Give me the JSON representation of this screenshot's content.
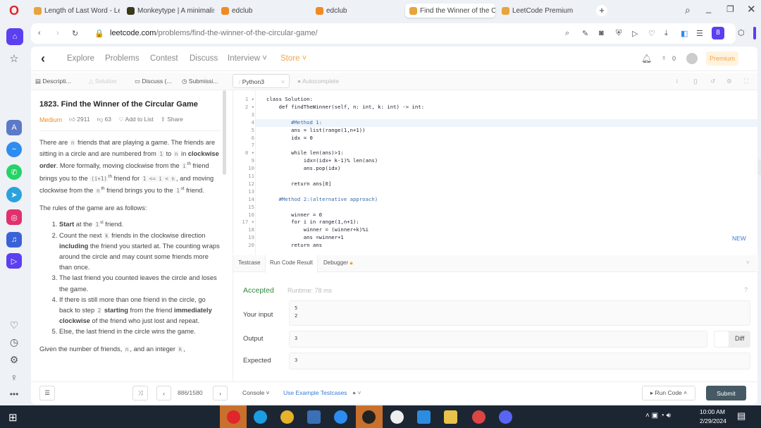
{
  "browser": {
    "tabs": [
      {
        "label": "Length of Last Word - Lee",
        "color": "#e8a33b"
      },
      {
        "label": "Monkeytype | A minimalis",
        "color": "#3a3a1a"
      },
      {
        "label": "edclub",
        "color": "#f08a24"
      },
      {
        "label": "edclub",
        "color": "#f08a24"
      },
      {
        "label": "Find the Winner of the Ci",
        "color": "#e8a33b"
      },
      {
        "label": "LeetCode Premium",
        "color": "#e8a33b"
      }
    ],
    "url_domain": "leetcode.com",
    "url_path": "/problems/find-the-winner-of-the-circular-game/"
  },
  "nav": {
    "items": [
      "Explore",
      "Problems",
      "Contest",
      "Discuss",
      "Interview ˅"
    ],
    "store": "Store ˅",
    "coins": "0",
    "premium": "Premium"
  },
  "subtabs": {
    "description": "Descripti...",
    "solution": "Solution",
    "discuss": "Discuss (...",
    "submissions": "Submissi...",
    "language": "Python3",
    "autocomplete": "Autocomplete"
  },
  "problem": {
    "title": "1823. Find the Winner of the Circular Game",
    "difficulty": "Medium",
    "likes": "2911",
    "dislikes": "63",
    "add_to_list": "Add to List",
    "share": "Share",
    "paragraphs": [
      [
        {
          "t": "There are "
        },
        {
          "c": "n"
        },
        {
          "t": " friends that are playing a game. The friends are sitting in a circle and are numbered from "
        },
        {
          "c": "1"
        },
        {
          "t": " to "
        },
        {
          "c": "n"
        },
        {
          "t": " in "
        },
        {
          "b": "clockwise order"
        },
        {
          "t": ". More formally, moving clockwise from the "
        },
        {
          "c": "i"
        },
        {
          "s": "th"
        },
        {
          "t": " friend brings you to the "
        },
        {
          "c": "(i+1)"
        },
        {
          "s": "th"
        },
        {
          "t": " friend for "
        },
        {
          "c": "1 <= i < n"
        },
        {
          "t": ", and moving clockwise from the "
        },
        {
          "c": "n"
        },
        {
          "s": "th"
        },
        {
          "t": " friend brings you to the "
        },
        {
          "c": "1"
        },
        {
          "s": "st"
        },
        {
          "t": " friend."
        }
      ],
      [
        {
          "t": "The rules of the game are as follows:"
        }
      ]
    ],
    "rules": [
      [
        {
          "b": "Start"
        },
        {
          "t": " at the "
        },
        {
          "c": "1"
        },
        {
          "s": "st"
        },
        {
          "t": " friend."
        }
      ],
      [
        {
          "t": "Count the next "
        },
        {
          "c": "k"
        },
        {
          "t": " friends in the clockwise direction "
        },
        {
          "b": "including"
        },
        {
          "t": " the friend you started at. The counting wraps around the circle and may count some friends more than once."
        }
      ],
      [
        {
          "t": "The last friend you counted leaves the circle and loses the game."
        }
      ],
      [
        {
          "t": "If there is still more than one friend in the circle, go back to step "
        },
        {
          "c": "2"
        },
        {
          "t": " "
        },
        {
          "b": "starting"
        },
        {
          "t": " from the friend "
        },
        {
          "b": "immediately clockwise"
        },
        {
          "t": " of the friend who just lost and repeat."
        }
      ],
      [
        {
          "t": "Else, the last friend in the circle wins the game."
        }
      ]
    ],
    "tail": [
      {
        "t": "Given the number of friends, "
      },
      {
        "c": "n"
      },
      {
        "t": ", and an integer "
      },
      {
        "c": "k"
      },
      {
        "t": ","
      }
    ]
  },
  "code": [
    "class Solution:",
    "    def findTheWinner(self, n: int, k: int) -> int:",
    "",
    "        #Method 1:",
    "        ans = list(range(1,n+1))",
    "        idx = 0",
    "",
    "        while len(ans)>1:",
    "            idx=(idx+ k-1)% len(ans)",
    "            ans.pop(idx)",
    "",
    "        return ans[0]",
    "",
    "    #Method 2:(alternative approach)",
    "",
    "        winner = 0",
    "        for i in range(1,n+1):",
    "            winner = (winner+k)%i",
    "            ans =winner+1",
    "        return ans"
  ],
  "result": {
    "tabs": [
      "Testcase",
      "Run Code Result",
      "Debugger"
    ],
    "status": "Accepted",
    "runtime": "Runtime: 78 ms",
    "input_label": "Your input",
    "input_lines": [
      "5",
      "2"
    ],
    "output_label": "Output",
    "output": "3",
    "diff": "Diff",
    "expected_label": "Expected",
    "expected": "3"
  },
  "bottom": {
    "pager": "886/1580",
    "console": "Console ˅",
    "example": "Use Example Testcases",
    "run": "▸ Run Code ˄",
    "submit": "Submit"
  },
  "new_badge": "NEW",
  "taskbar": {
    "time": "10:00 AM",
    "date": "2/29/2024"
  },
  "colors": {
    "accent": "#ffa116",
    "accepted": "#2e8b3e",
    "medium": "#ef8d25",
    "opera": "#e0252b",
    "submit": "#455a64"
  }
}
